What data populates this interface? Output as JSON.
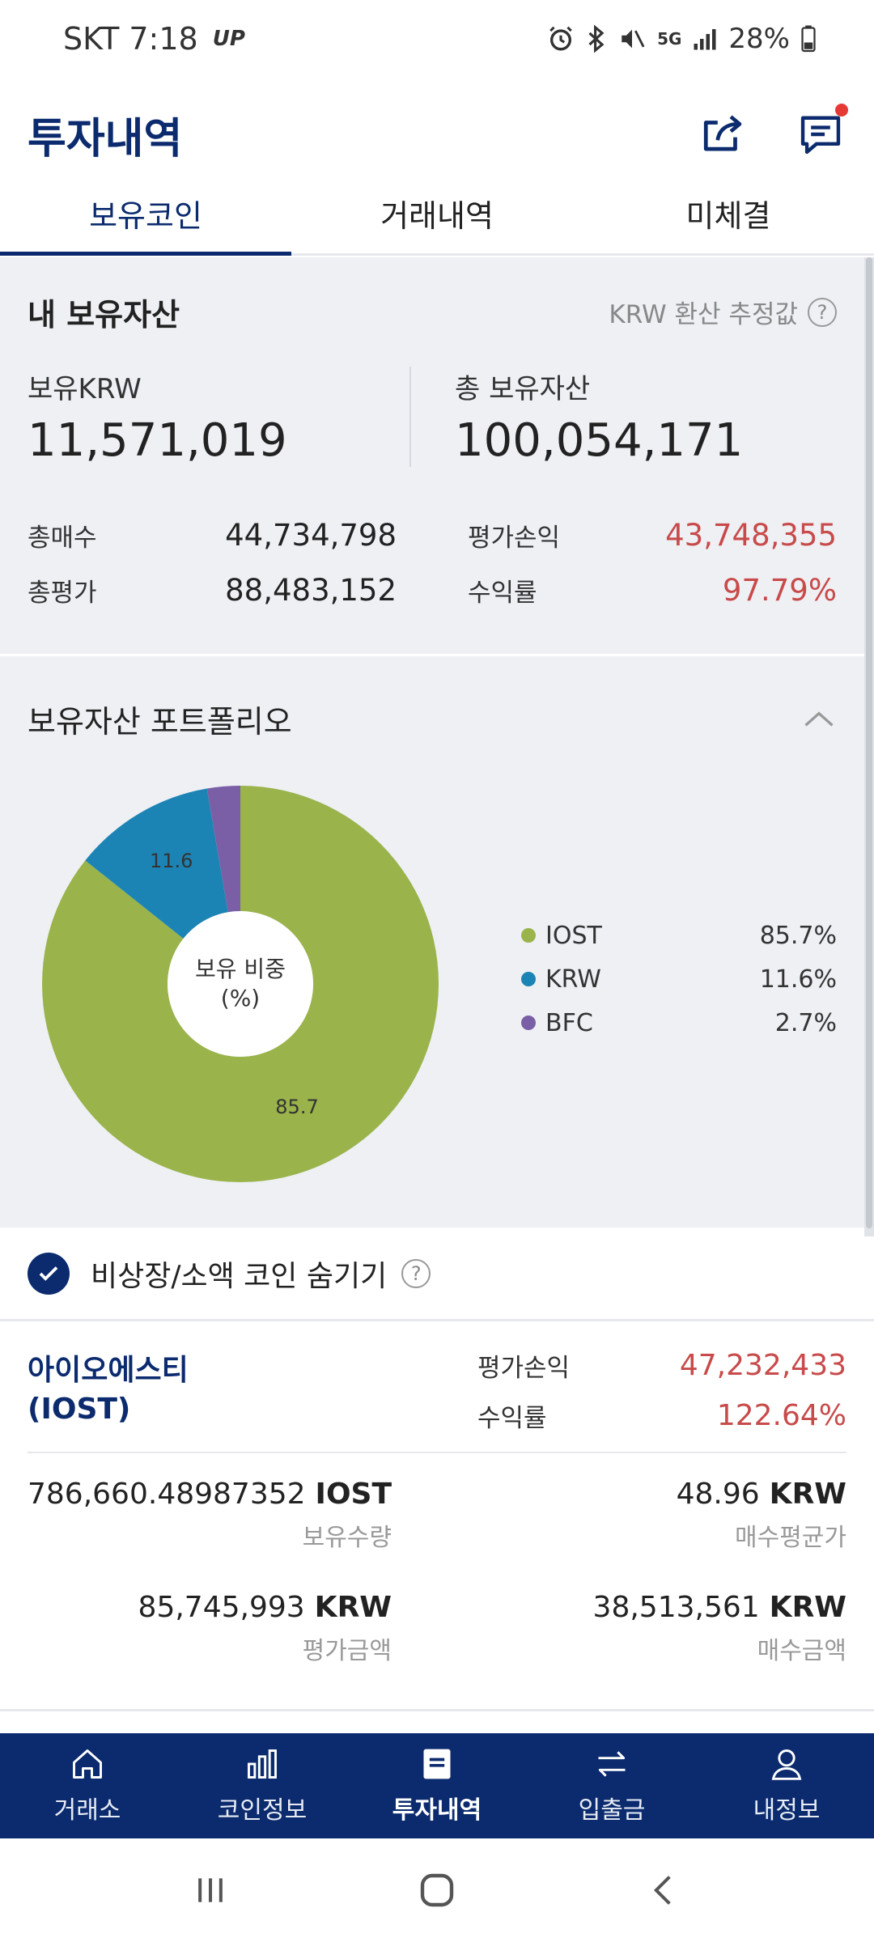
{
  "status_bar": {
    "carrier_time": "SKT 7:18",
    "up_badge": "UP",
    "network": "5G",
    "battery": "28%"
  },
  "header": {
    "title": "투자내역",
    "share_icon": "share-icon",
    "chat_icon": "chat-icon"
  },
  "tabs": [
    {
      "label": "보유코인",
      "active": true
    },
    {
      "label": "거래내역",
      "active": false
    },
    {
      "label": "미체결",
      "active": false
    }
  ],
  "assets": {
    "title": "내 보유자산",
    "note": "KRW 환산 추정값",
    "krw_label": "보유KRW",
    "krw_value": "11,571,019",
    "total_label": "총 보유자산",
    "total_value": "100,054,171",
    "buy_label": "총매수",
    "buy_value": "44,734,798",
    "eval_label": "총평가",
    "eval_value": "88,483,152",
    "pnl_label": "평가손익",
    "pnl_value": "43,748,355",
    "rate_label": "수익률",
    "rate_value": "97.79%"
  },
  "portfolio": {
    "title": "보유자산 포트폴리오",
    "center_line1": "보유 비중",
    "center_line2": "(%)",
    "slice_label_iost": "85.7",
    "slice_label_krw": "11.6"
  },
  "chart_data": {
    "type": "pie",
    "categories": [
      "IOST",
      "KRW",
      "BFC"
    ],
    "values": [
      85.7,
      11.6,
      2.7
    ],
    "value_labels": [
      "85.7%",
      "11.6%",
      "2.7%"
    ],
    "colors": [
      "#9ab34b",
      "#1c84b4",
      "#7a5fa6"
    ],
    "legend": "right"
  },
  "hide_small": {
    "label": "비상장/소액 코인 숨기기",
    "checked": true
  },
  "coin": {
    "name_line1": "아이오에스티",
    "name_line2": "(IOST)",
    "pnl_label": "평가손익",
    "pnl_value": "47,232,433",
    "rate_label": "수익률",
    "rate_value": "122.64%",
    "qty_value": "786,660.48987352",
    "qty_unit": "IOST",
    "qty_label": "보유수량",
    "avg_value": "48.96",
    "avg_unit": "KRW",
    "avg_label": "매수평균가",
    "evalamt_value": "85,745,993",
    "evalamt_unit": "KRW",
    "evalamt_label": "평가금액",
    "buyamt_value": "38,513,561",
    "buyamt_unit": "KRW",
    "buyamt_label": "매수금액"
  },
  "bottom_nav": [
    {
      "label": "거래소",
      "icon": "home-icon"
    },
    {
      "label": "코인정보",
      "icon": "chart-icon"
    },
    {
      "label": "투자내역",
      "icon": "list-icon",
      "active": true
    },
    {
      "label": "입출금",
      "icon": "transfer-icon"
    },
    {
      "label": "내정보",
      "icon": "person-icon"
    }
  ],
  "colors": {
    "brand": "#0b2b6e",
    "negative": "#c84a4a",
    "panel_bg": "#eef0f4"
  }
}
